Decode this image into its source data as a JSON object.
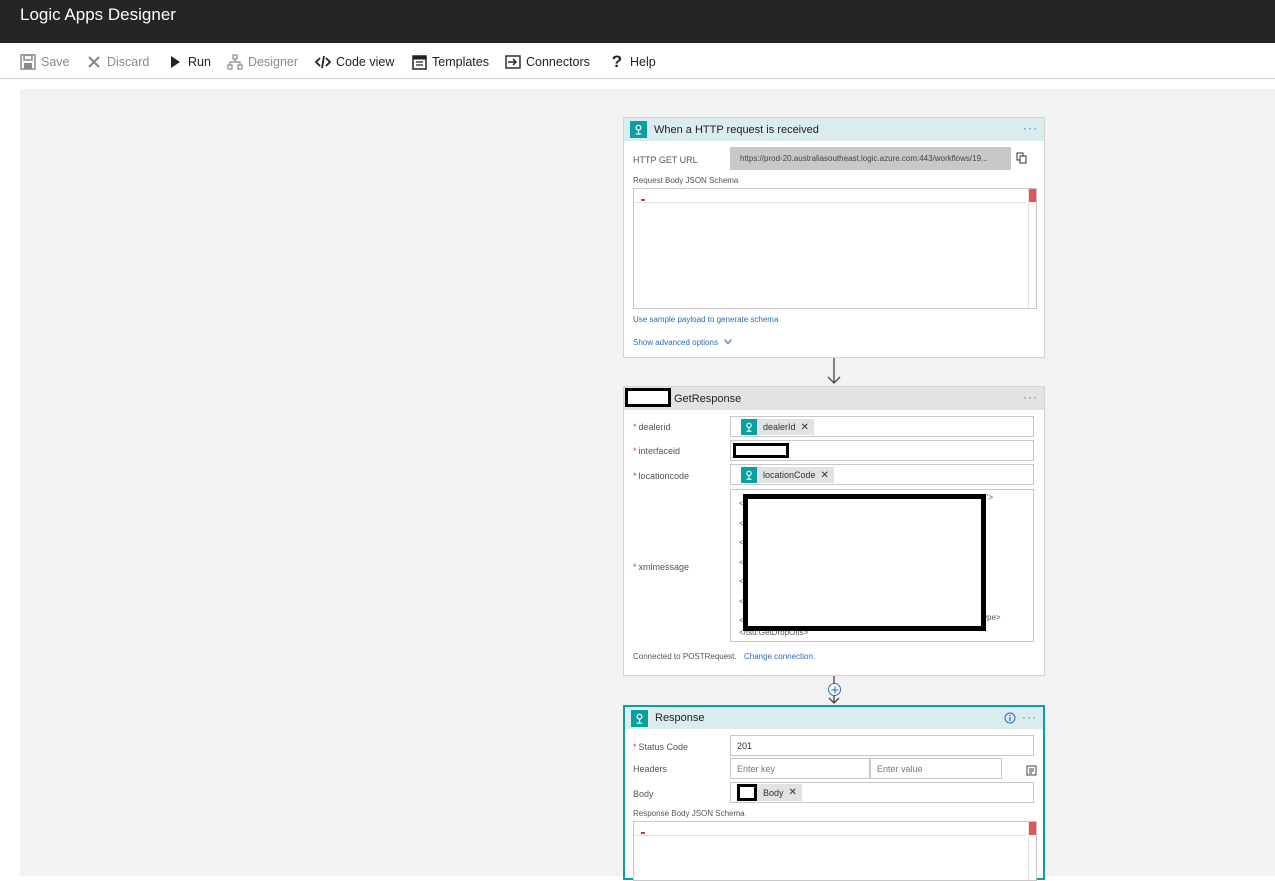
{
  "app": {
    "title": "Logic Apps Designer"
  },
  "toolbar": {
    "save": "Save",
    "discard": "Discard",
    "run": "Run",
    "designer": "Designer",
    "code_view": "Code view",
    "templates": "Templates",
    "connectors": "Connectors",
    "help": "Help"
  },
  "trigger": {
    "title": "When a HTTP request is received",
    "menu": "···",
    "http_get_url_label": "HTTP GET URL",
    "http_get_url_value": "https://prod-20.australiasoutheast.logic.azure.com:443/workflows/19...",
    "schema_label": "Request Body JSON Schema",
    "sample_payload_link": "Use sample payload to generate schema",
    "advanced_link": "Show advanced options"
  },
  "action": {
    "title": "GetResponse",
    "menu": "···",
    "dealerid_label": "dealerid",
    "dealerid_token": "dealerId",
    "interfaceid_label": "interfaceid",
    "locationcode_label": "locationcode",
    "locationcode_token": "locationCode",
    "xmlmessage_label": "xmlmessage",
    "xml_line_end_1": "'>",
    "xml_line_end_2": "ype>",
    "xml_last_line": "</tsu:GetDropOffs>",
    "connected_text": "Connected to POSTRequest.",
    "change_connection": "Change connection."
  },
  "response": {
    "title": "Response",
    "menu": "···",
    "status_code_label": "Status Code",
    "status_code_value": "201",
    "headers_label": "Headers",
    "enter_key": "Enter key",
    "enter_value": "Enter value",
    "body_label": "Body",
    "body_token": "Body",
    "schema_label": "Response Body JSON Schema"
  },
  "colors": {
    "accent": "#0aa0a0",
    "link": "#2a6bbd",
    "titlebar": "#252525"
  }
}
